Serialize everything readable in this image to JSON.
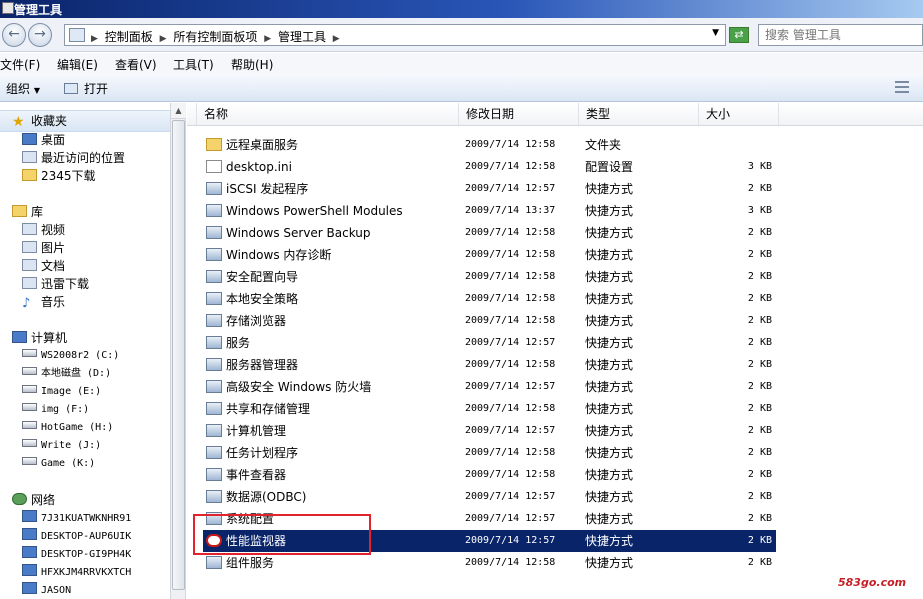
{
  "window": {
    "title": "管理工具",
    "icon": "admin-tools-window-icon"
  },
  "address": {
    "icon": "control-panel-icon",
    "crumbs": [
      "控制面板",
      "所有控制面板项",
      "管理工具"
    ],
    "search_placeholder": "搜索 管理工具"
  },
  "menu": [
    "文件(F)",
    "编辑(E)",
    "查看(V)",
    "工具(T)",
    "帮助(H)"
  ],
  "toolbar": {
    "organize": "组织",
    "open": "打开"
  },
  "nav": {
    "favorites": {
      "label": "收藏夹",
      "items": [
        "桌面",
        "最近访问的位置",
        "2345下载"
      ]
    },
    "libraries": {
      "label": "库",
      "items": [
        "视频",
        "图片",
        "文档",
        "迅雷下载",
        "音乐"
      ]
    },
    "computer": {
      "label": "计算机",
      "items": [
        "WS2008r2 (C:)",
        "本地磁盘 (D:)",
        "Image (E:)",
        "img (F:)",
        "HotGame (H:)",
        "Write (J:)",
        "Game (K:)"
      ]
    },
    "network": {
      "label": "网络",
      "items": [
        "7J31KUATWKNHR91",
        "DESKTOP-AUP6UIK",
        "DESKTOP-GI9PH4K",
        "HFXKJM4RRVKXTCH",
        "JASON"
      ]
    }
  },
  "columns": {
    "name": "名称",
    "date": "修改日期",
    "type": "类型",
    "size": "大小"
  },
  "files": [
    {
      "name": "远程桌面服务",
      "date": "2009/7/14 12:58",
      "type": "文件夹",
      "size": "",
      "icon": "folder-icon"
    },
    {
      "name": "desktop.ini",
      "date": "2009/7/14 12:58",
      "type": "配置设置",
      "size": "3 KB",
      "icon": "settings-file-icon"
    },
    {
      "name": "iSCSI 发起程序",
      "date": "2009/7/14 12:57",
      "type": "快捷方式",
      "size": "2 KB",
      "icon": "iscsi-icon"
    },
    {
      "name": "Windows PowerShell Modules",
      "date": "2009/7/14 13:37",
      "type": "快捷方式",
      "size": "3 KB",
      "icon": "powershell-icon"
    },
    {
      "name": "Windows Server Backup",
      "date": "2009/7/14 12:58",
      "type": "快捷方式",
      "size": "2 KB",
      "icon": "backup-icon"
    },
    {
      "name": "Windows 内存诊断",
      "date": "2009/7/14 12:58",
      "type": "快捷方式",
      "size": "2 KB",
      "icon": "memory-diagnostic-icon"
    },
    {
      "name": "安全配置向导",
      "date": "2009/7/14 12:58",
      "type": "快捷方式",
      "size": "2 KB",
      "icon": "security-wizard-icon"
    },
    {
      "name": "本地安全策略",
      "date": "2009/7/14 12:58",
      "type": "快捷方式",
      "size": "2 KB",
      "icon": "security-policy-icon"
    },
    {
      "name": "存储浏览器",
      "date": "2009/7/14 12:58",
      "type": "快捷方式",
      "size": "2 KB",
      "icon": "storage-explorer-icon"
    },
    {
      "name": "服务",
      "date": "2009/7/14 12:57",
      "type": "快捷方式",
      "size": "2 KB",
      "icon": "services-icon"
    },
    {
      "name": "服务器管理器",
      "date": "2009/7/14 12:58",
      "type": "快捷方式",
      "size": "2 KB",
      "icon": "server-manager-icon"
    },
    {
      "name": "高级安全 Windows 防火墙",
      "date": "2009/7/14 12:57",
      "type": "快捷方式",
      "size": "2 KB",
      "icon": "firewall-icon"
    },
    {
      "name": "共享和存储管理",
      "date": "2009/7/14 12:58",
      "type": "快捷方式",
      "size": "2 KB",
      "icon": "share-storage-icon"
    },
    {
      "name": "计算机管理",
      "date": "2009/7/14 12:57",
      "type": "快捷方式",
      "size": "2 KB",
      "icon": "computer-management-icon"
    },
    {
      "name": "任务计划程序",
      "date": "2009/7/14 12:58",
      "type": "快捷方式",
      "size": "2 KB",
      "icon": "task-scheduler-icon"
    },
    {
      "name": "事件查看器",
      "date": "2009/7/14 12:58",
      "type": "快捷方式",
      "size": "2 KB",
      "icon": "event-viewer-icon"
    },
    {
      "name": "数据源(ODBC)",
      "date": "2009/7/14 12:57",
      "type": "快捷方式",
      "size": "2 KB",
      "icon": "odbc-icon"
    },
    {
      "name": "系统配置",
      "date": "2009/7/14 12:57",
      "type": "快捷方式",
      "size": "2 KB",
      "icon": "system-config-icon"
    },
    {
      "name": "性能监视器",
      "date": "2009/7/14 12:57",
      "type": "快捷方式",
      "size": "2 KB",
      "icon": "performance-monitor-icon",
      "selected": true
    },
    {
      "name": "组件服务",
      "date": "2009/7/14 12:58",
      "type": "快捷方式",
      "size": "2 KB",
      "icon": "component-services-icon"
    }
  ],
  "colors": {
    "selection": "#0a246a",
    "highlight_box": "#e0232c",
    "watermark": "#c51f25"
  },
  "watermark": "583go.com"
}
